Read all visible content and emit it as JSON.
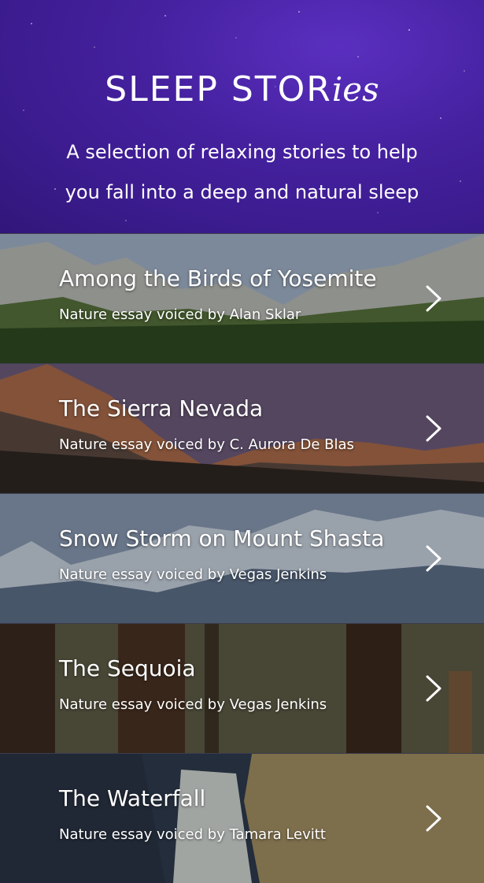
{
  "header": {
    "title_plain": "SLEEP STOR",
    "title_script": "ies",
    "subtitle": "A selection of relaxing stories to help you fall into a deep and natural sleep",
    "background_color": "#3d1c91"
  },
  "stories": [
    {
      "title": "Among the Birds of Yosemite",
      "description": "Nature essay voiced by Alan Sklar"
    },
    {
      "title": "The Sierra Nevada",
      "description": "Nature essay voiced by C. Aurora De Blas"
    },
    {
      "title": "Snow Storm on Mount Shasta",
      "description": "Nature essay voiced by Vegas Jenkins"
    },
    {
      "title": "The Sequoia",
      "description": "Nature essay voiced by Vegas Jenkins"
    },
    {
      "title": "The Waterfall",
      "description": "Nature essay voiced by Tamara Levitt"
    }
  ],
  "icons": {
    "row_arrow": "chevron-right-icon"
  }
}
